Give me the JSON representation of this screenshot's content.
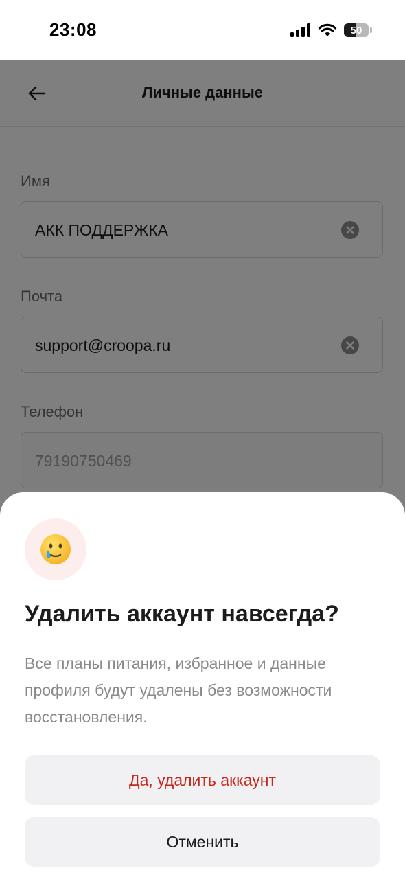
{
  "status_bar": {
    "time": "23:08",
    "battery_percent": "50",
    "signal_icon": "cellular-signal-icon",
    "wifi_icon": "wifi-icon"
  },
  "header": {
    "back_icon": "arrow-left-icon",
    "title": "Личные данные"
  },
  "form": {
    "name_label": "Имя",
    "name_value": "АКК ПОДДЕРЖКА",
    "email_label": "Почта",
    "email_value": "support@croopa.ru",
    "phone_label": "Телефон",
    "phone_value": "79190750469",
    "clear_icon": "clear-x-circle-icon"
  },
  "dialog": {
    "emoji_icon": "smiling-face-with-tear-icon",
    "title": "Удалить аккаунт навсегда?",
    "description": "Все планы питания, избранное и данные профиля будут удалены без возможности восстановления.",
    "confirm_label": "Да, удалить аккаунт",
    "cancel_label": "Отменить"
  },
  "colors": {
    "danger": "#c6281c",
    "button_bg": "#f1f1f4",
    "overlay": "rgba(0,0,0,0.5)",
    "emoji_bg": "#fdeeee"
  }
}
